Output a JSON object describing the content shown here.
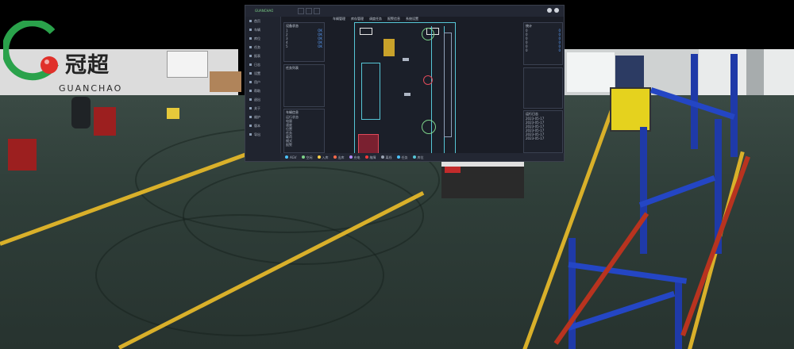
{
  "logo": {
    "title": "冠超",
    "subtitle": "GUANCHAO",
    "colors": {
      "green": "#2aa24b",
      "red": "#e0302a"
    }
  },
  "dashboard": {
    "brand": "GUANCHAO",
    "tabs": [
      "",
      "",
      ""
    ],
    "top_nav": [
      "车辆管理",
      "库存管理",
      "调度任务",
      "报警信息",
      "系统设置"
    ],
    "sidebar": [
      "首页",
      "车辆",
      "库位",
      "任务",
      "报表",
      "日志",
      "设置",
      "用户",
      "帮助",
      "退出",
      "关于",
      "维护",
      "版本",
      "导出"
    ],
    "left_panel_title": "设备状态",
    "left_panel_rows": [
      [
        "1",
        "OK"
      ],
      [
        "2",
        "OK"
      ],
      [
        "3",
        "OK"
      ],
      [
        "4",
        "OK"
      ],
      [
        "5",
        "OK"
      ]
    ],
    "mid_panel_title": "任务列表",
    "info_panel_title": "车辆信息",
    "info_rows": [
      "运行状态",
      "电量",
      "速度",
      "位置",
      "任务",
      "载荷",
      "模式",
      "报警"
    ],
    "right_panel_title": "统计",
    "right_rows": [
      [
        "0",
        "0"
      ],
      [
        "0",
        "0"
      ],
      [
        "0",
        "0"
      ],
      [
        "0",
        "0"
      ],
      [
        "0",
        "0"
      ],
      [
        "0",
        "0"
      ]
    ],
    "log_panel_title": "运行日志",
    "log_rows": [
      "2023-05-17",
      "2023-05-17",
      "2023-05-17",
      "2023-05-17",
      "2023-05-17",
      "2023-05-17"
    ],
    "map_labels": [
      "",
      "",
      ""
    ],
    "legend": [
      {
        "label": "AGV",
        "color": "#4cc3ff"
      },
      {
        "label": "空闲",
        "color": "#7ed38a"
      },
      {
        "label": "入库",
        "color": "#ffd24a"
      },
      {
        "label": "出库",
        "color": "#ff6a4a"
      },
      {
        "label": "充电",
        "color": "#b38cff"
      },
      {
        "label": "故障",
        "color": "#ff3a3a"
      },
      {
        "label": "离线",
        "color": "#9aa3b2"
      },
      {
        "label": "任务",
        "color": "#4cc3ff"
      },
      {
        "label": "库位",
        "color": "#56c6d6"
      }
    ]
  }
}
